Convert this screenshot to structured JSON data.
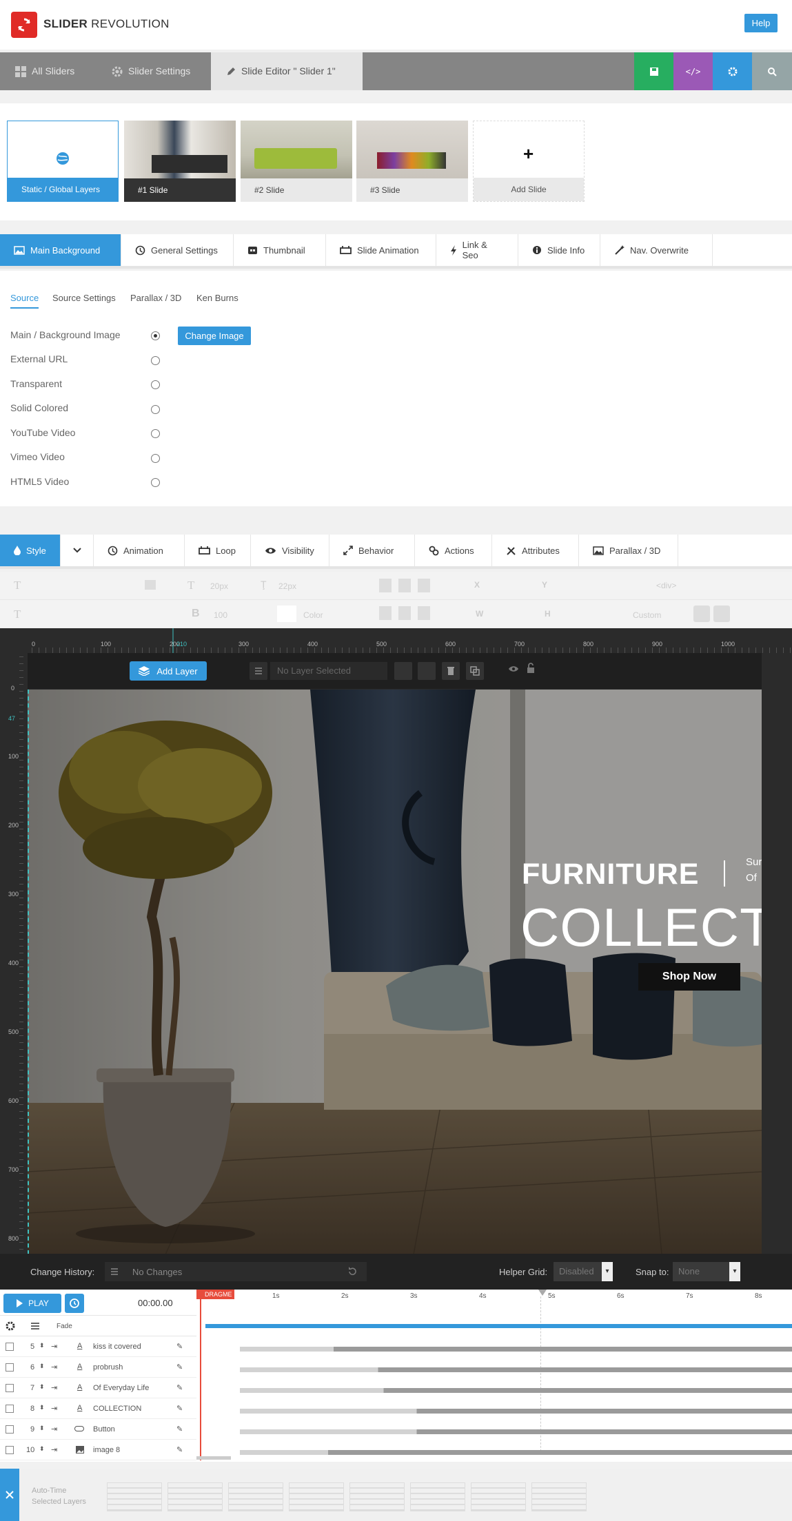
{
  "header": {
    "brand_bold": "SLIDER",
    "brand_light": "REVOLUTION",
    "help": "Help"
  },
  "topnav": {
    "all_sliders": "All Sliders",
    "slider_settings": "Slider Settings",
    "slide_editor": "Slide Editor \" Slider 1\""
  },
  "slides": [
    {
      "label": "Static / Global Layers"
    },
    {
      "label": "#1 Slide"
    },
    {
      "label": "#2 Slide"
    },
    {
      "label": "#3 Slide"
    },
    {
      "label": "Add Slide"
    }
  ],
  "bgtabs": [
    "Main Background",
    "General Settings",
    "Thumbnail",
    "Slide Animation",
    "Link & Seo",
    "Slide Info",
    "Nav. Overwrite"
  ],
  "subtabs": [
    "Source",
    "Source Settings",
    "Parallax / 3D",
    "Ken Burns"
  ],
  "sources": [
    "Main / Background Image",
    "External URL",
    "Transparent",
    "Solid Colored",
    "YouTube Video",
    "Vimeo Video",
    "HTML5 Video"
  ],
  "change_image": "Change Image",
  "layertabs": [
    "Style",
    "Animation",
    "Loop",
    "Visibility",
    "Behavior",
    "Actions",
    "Attributes",
    "Parallax / 3D"
  ],
  "toolrow": {
    "t1": "T",
    "t2": "T",
    "size1": "20px",
    "size2": "22px",
    "x": "X",
    "y": "Y",
    "div": "<div>",
    "w": "W",
    "h": "H",
    "weight": "100",
    "color": "Color",
    "custom": "Custom"
  },
  "ruler": {
    "top": [
      "0",
      "100",
      "200",
      "210",
      "300",
      "400",
      "500",
      "600",
      "700",
      "800",
      "900",
      "1000"
    ],
    "left": [
      "0",
      "47",
      "100",
      "200",
      "300",
      "400",
      "500",
      "600",
      "700",
      "800"
    ]
  },
  "layerbar": {
    "add_layer": "Add Layer",
    "no_layer": "No Layer Selected"
  },
  "canvas": {
    "furniture": "FURNITURE",
    "collection": "COLLECT",
    "side1": "Sur",
    "side2": "Of",
    "shop": "Shop Now"
  },
  "changebar": {
    "history_label": "Change History:",
    "history_value": "No Changes",
    "helper_grid": "Helper Grid:",
    "helper_value": "Disabled",
    "snap": "Snap to:",
    "snap_value": "None"
  },
  "timeline": {
    "play": "PLAY",
    "time": "00:00.00",
    "dragme": "DRAGME",
    "ticks": [
      "1s",
      "2s",
      "3s",
      "4s",
      "5s",
      "6s",
      "7s",
      "8s"
    ],
    "fade": "Fade",
    "layers": [
      {
        "num": "5",
        "name": "kiss it covered"
      },
      {
        "num": "6",
        "name": "probrush"
      },
      {
        "num": "7",
        "name": "Of Everyday Life"
      },
      {
        "num": "8",
        "name": "COLLECTION"
      },
      {
        "num": "9",
        "name": "Button"
      },
      {
        "num": "10",
        "name": "image 8"
      }
    ]
  },
  "footer": {
    "auto1": "Auto-Time",
    "auto2": "Selected Layers"
  },
  "colors": {
    "accent": "#3498db",
    "save": "#27ae60",
    "code": "#9b59b6",
    "settings": "#3498db",
    "search": "#95a5a6",
    "logo": "#e02b27"
  }
}
